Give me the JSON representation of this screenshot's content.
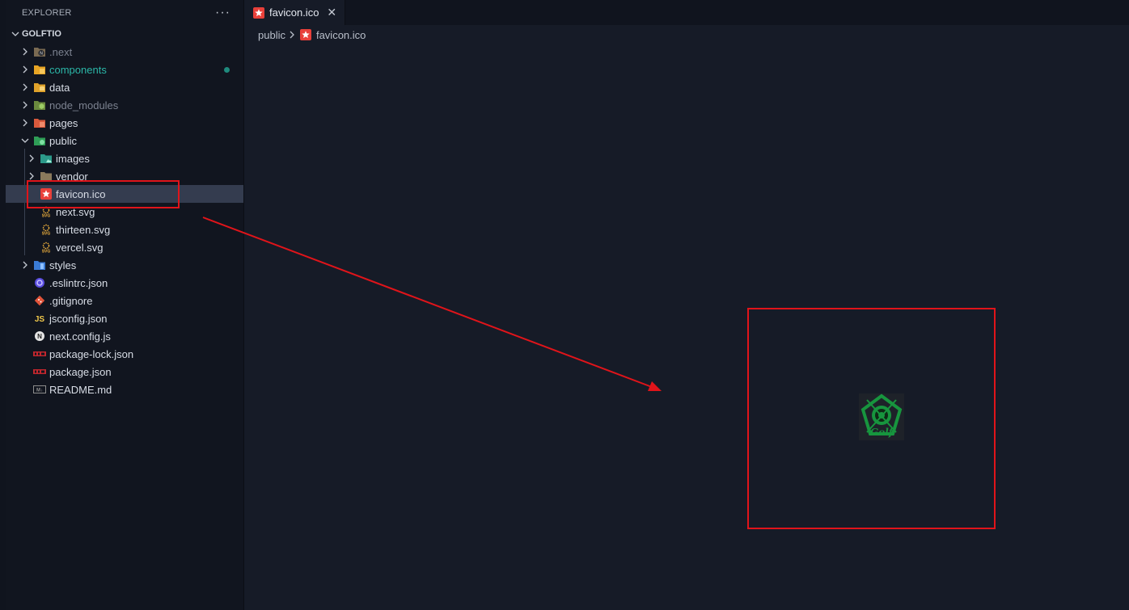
{
  "explorer": {
    "title": "EXPLORER",
    "more_label": "···",
    "root": "GOLFTIO",
    "items": [
      {
        "label": ".next",
        "icon": "next-folder-icon",
        "type": "folder"
      },
      {
        "label": "components",
        "icon": "components-folder-icon",
        "type": "folder"
      },
      {
        "label": "data",
        "icon": "data-folder-icon",
        "type": "folder"
      },
      {
        "label": "node_modules",
        "icon": "node-folder-icon",
        "type": "folder"
      },
      {
        "label": "pages",
        "icon": "pages-folder-icon",
        "type": "folder"
      },
      {
        "label": "public",
        "icon": "public-folder-icon",
        "type": "folder-open"
      },
      {
        "label": "images",
        "icon": "images-folder-icon",
        "type": "folder"
      },
      {
        "label": "vendor",
        "icon": "vendor-folder-icon",
        "type": "folder"
      },
      {
        "label": "favicon.ico",
        "icon": "favicon-icon",
        "type": "file"
      },
      {
        "label": "next.svg",
        "icon": "svg-file-icon",
        "type": "file"
      },
      {
        "label": "thirteen.svg",
        "icon": "svg-file-icon",
        "type": "file"
      },
      {
        "label": "vercel.svg",
        "icon": "svg-file-icon",
        "type": "file"
      },
      {
        "label": "styles",
        "icon": "styles-folder-icon",
        "type": "folder"
      },
      {
        "label": ".eslintrc.json",
        "icon": "eslint-icon",
        "type": "file"
      },
      {
        "label": ".gitignore",
        "icon": "git-icon",
        "type": "file"
      },
      {
        "label": "jsconfig.json",
        "icon": "js-icon",
        "type": "file"
      },
      {
        "label": "next.config.js",
        "icon": "next-icon",
        "type": "file"
      },
      {
        "label": "package-lock.json",
        "icon": "npm-icon",
        "type": "file"
      },
      {
        "label": "package.json",
        "icon": "npm-icon",
        "type": "file"
      },
      {
        "label": "README.md",
        "icon": "markdown-icon",
        "type": "file"
      }
    ]
  },
  "editor": {
    "tab_label": "favicon.ico",
    "tab_close": "✕",
    "breadcrumb": [
      "public",
      "favicon.ico"
    ]
  },
  "colors": {
    "background": "#161b27",
    "sidebar": "#11151f",
    "annotation_red": "#e0141a",
    "selection": "#343c4f",
    "modified": "#2bb7a8"
  }
}
